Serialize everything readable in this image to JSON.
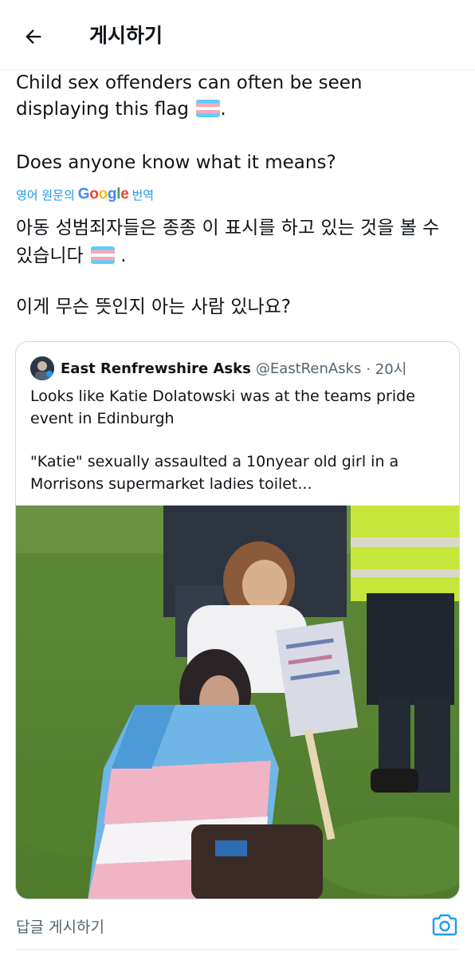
{
  "header": {
    "title": "게시하기"
  },
  "post": {
    "original_line1": "Child sex offenders can often be seen",
    "original_line2": "displaying this flag",
    "original_line2_end": ".",
    "original_line3": "Does anyone know what it means?",
    "translate_prefix": "영어 원문의",
    "translate_suffix": "번역",
    "translated_line1": "아동 성범죄자들은 종종 이 표시를 하고 있는 것을 볼 수",
    "translated_line2": "있습니다",
    "translated_line2_end": ".",
    "translated_line3": "이게 무슨 뜻인지 아는 사람 있나요?"
  },
  "quote": {
    "name": "East Renfrewshire Asks",
    "handle": "@EastRenAsks",
    "time": "· 20시",
    "line1": "Looks like Katie Dolatowski was at the teams pride",
    "line2": "event in Edinburgh",
    "line3": "\"Katie\" sexually assaulted a 10nyear old girl in a",
    "line4": "Morrisons supermarket ladies toilet..."
  },
  "reply": {
    "placeholder": "답글 게시하기"
  },
  "colors": {
    "link": "#1d9bf0",
    "text": "#0f1419",
    "muted": "#536471",
    "border": "#cfd9de"
  }
}
